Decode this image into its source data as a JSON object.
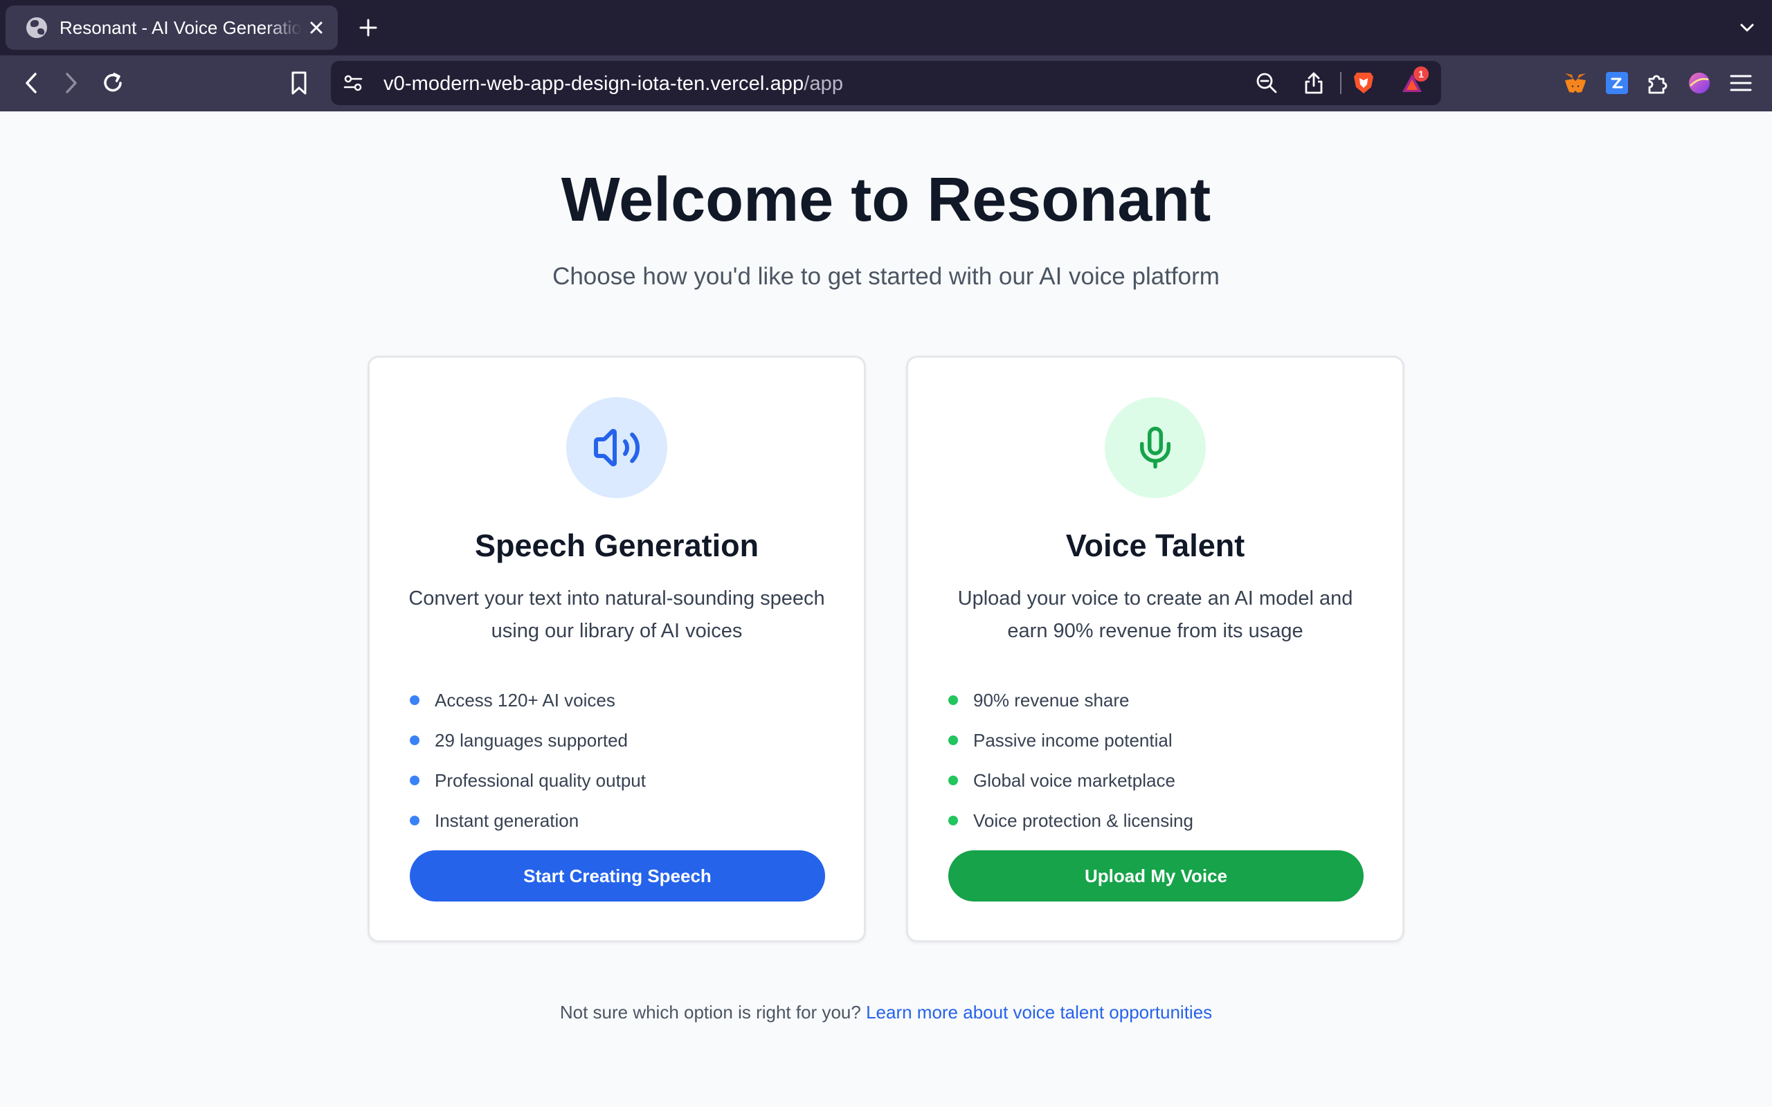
{
  "browser": {
    "tab_title": "Resonant - AI Voice Generation",
    "url_domain": "v0-modern-web-app-design-iota-ten.vercel.app",
    "url_path": "/app",
    "notification_count": "1",
    "icons": [
      "back-icon",
      "forward-icon",
      "reload-icon",
      "bookmark-icon",
      "site-settings-icon",
      "zoom-out-icon",
      "share-icon",
      "brave-shields-icon",
      "brave-rewards-icon",
      "metamask-icon",
      "extension-blue-icon",
      "extensions-icon",
      "profile-icon",
      "menu-icon"
    ]
  },
  "page": {
    "title": "Welcome to Resonant",
    "subtitle": "Choose how you'd like to get started with our AI voice platform"
  },
  "cards": [
    {
      "title": "Speech Generation",
      "description": "Convert your text into natural-sounding speech using our library of AI voices",
      "features": [
        "Access 120+ AI voices",
        "29 languages supported",
        "Professional quality output",
        "Instant generation"
      ],
      "button_label": "Start Creating Speech",
      "icon": "speaker-icon",
      "accent": "#2563eb",
      "icon_bg": "#dbeafe",
      "dot_color": "#3b82f6"
    },
    {
      "title": "Voice Talent",
      "description": "Upload your voice to create an AI model and earn 90% revenue from its usage",
      "features": [
        "90% revenue share",
        "Passive income potential",
        "Global voice marketplace",
        "Voice protection & licensing"
      ],
      "button_label": "Upload My Voice",
      "icon": "microphone-icon",
      "accent": "#16a34a",
      "icon_bg": "#dcfce7",
      "dot_color": "#22c55e"
    }
  ],
  "footer": {
    "prompt": "Not sure which option is right for you?",
    "link_text": "Learn more about voice talent opportunities"
  }
}
